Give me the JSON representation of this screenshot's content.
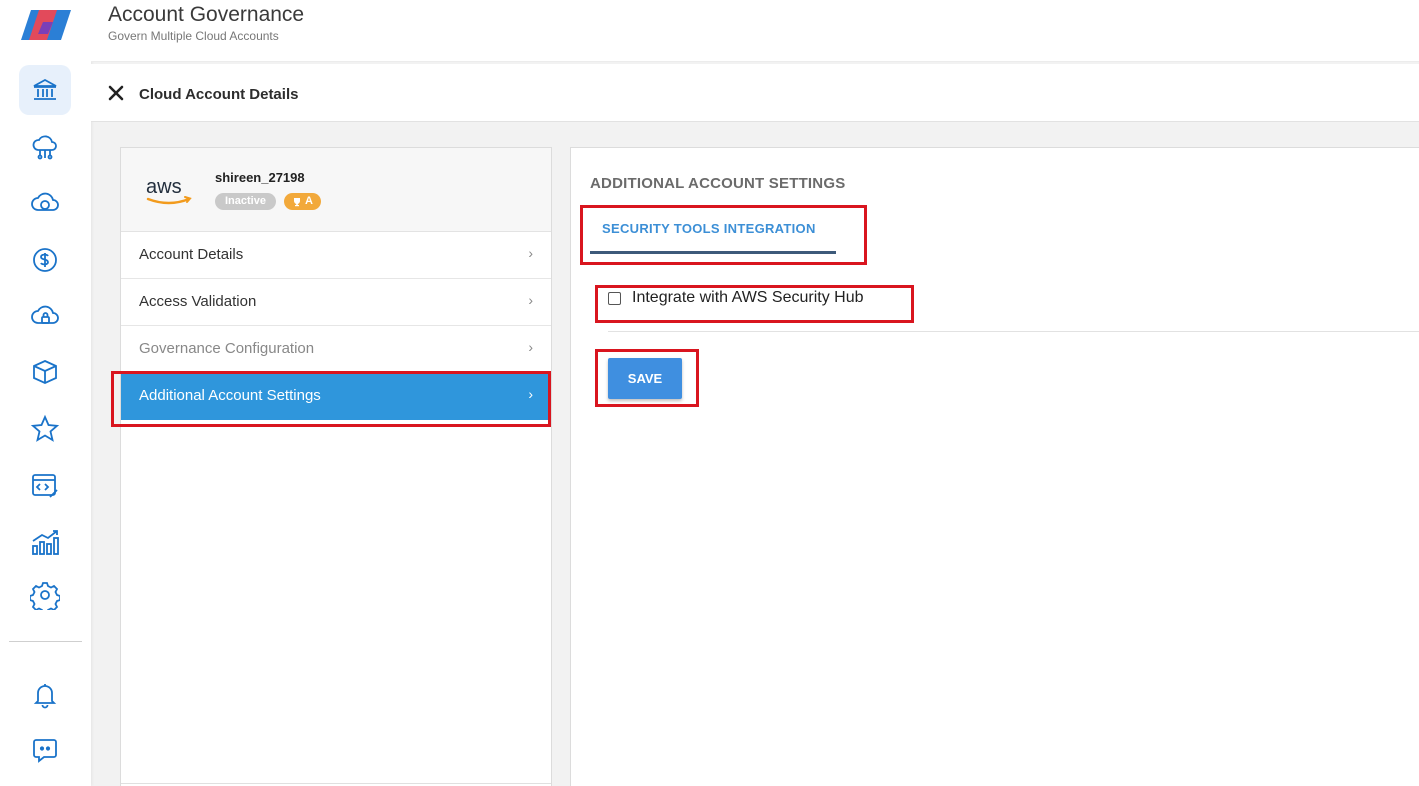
{
  "header": {
    "title": "Account Governance",
    "subtitle": "Govern Multiple Cloud Accounts"
  },
  "subheader": {
    "title": "Cloud Account Details",
    "close_icon": "close-icon"
  },
  "sidebar": {
    "icons": [
      "governance-icon",
      "cloud-network-icon",
      "cloud-sync-icon",
      "dollar-icon",
      "cloud-lock-icon",
      "cube-icon",
      "star-icon",
      "code-tools-icon",
      "growth-chart-icon",
      "gear-icon",
      "bell-icon",
      "chat-icon"
    ],
    "active": "governance-icon"
  },
  "account": {
    "provider_logo": "aws",
    "name": "shireen_27198",
    "status": "Inactive",
    "grade": "A"
  },
  "menu": [
    {
      "label": "Account Details",
      "state": "normal"
    },
    {
      "label": "Access Validation",
      "state": "normal"
    },
    {
      "label": "Governance Configuration",
      "state": "disabled"
    },
    {
      "label": "Additional Account Settings",
      "state": "active"
    }
  ],
  "main": {
    "section_title": "ADDITIONAL ACCOUNT SETTINGS",
    "tab_label": "SECURITY TOOLS INTEGRATION",
    "checkbox_label": "Integrate with AWS Security Hub",
    "checkbox_checked": false,
    "save_label": "SAVE"
  },
  "colors": {
    "accent": "#2f96dc",
    "button": "#3f8fe0",
    "tab_text": "#3c8fd6",
    "highlight": "#d9151f",
    "grade_badge": "#f2a93b"
  }
}
